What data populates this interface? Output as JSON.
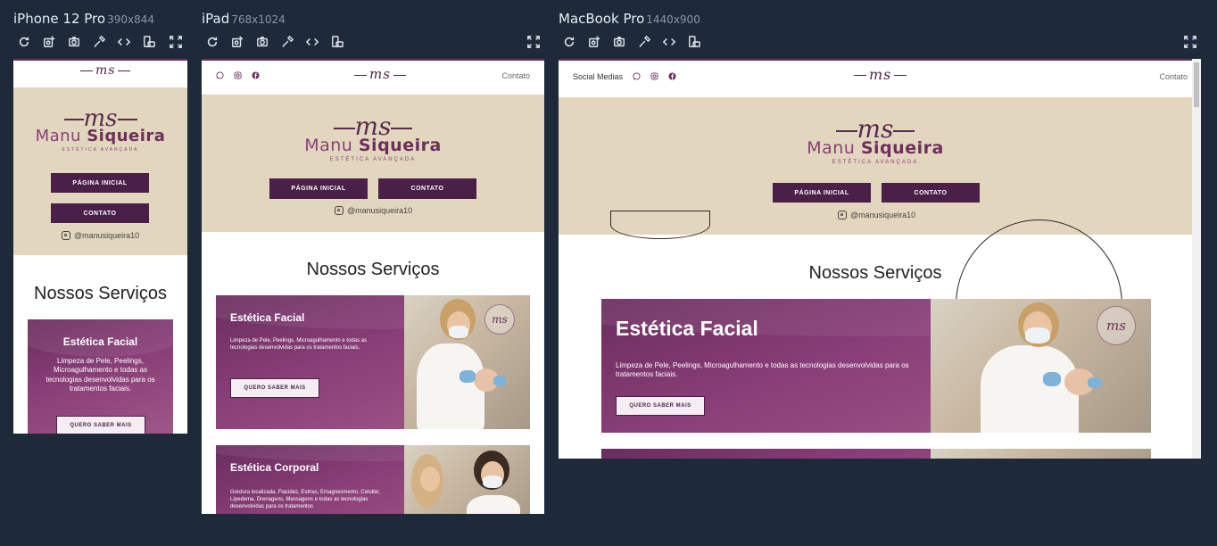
{
  "devices": [
    {
      "name": "iPhone 12 Pro",
      "dims": "390x844"
    },
    {
      "name": "iPad",
      "dims": "768x1024"
    },
    {
      "name": "MacBook Pro",
      "dims": "1440x900"
    }
  ],
  "site": {
    "logo_mark": "ms",
    "brand_name_light": "Manu",
    "brand_name_bold": "Siqueira",
    "brand_tagline": "ESTÉTICA AVANÇADA",
    "nav_contact": "Contato",
    "social_medias_label": "Social Medias",
    "btn_home": "PÁGINA INICIAL",
    "btn_contact": "CONTATO",
    "instagram_handle": "@manusiqueira10",
    "services_title": "Nossos Serviços",
    "card1": {
      "title": "Estética Facial",
      "desc_long": "Limpeza de Pele, Peelings, Microagulhamento e todas as tecnologias desenvolvidas para os tratamentos faciais.",
      "button": "QUERO SABER MAIS"
    },
    "card2": {
      "title": "Estética Corporal",
      "desc": "Gordura localizada, Flacidez, Estrias, Emagrecimento, Celulite, Lipedema, Drenagens, Massagens e todas as tecnologias desenvolvidas para os tratamentos"
    }
  },
  "colors": {
    "background": "#1e2a3a",
    "brand_purple": "#6e2f5a",
    "hero_beige": "#e3d6bf",
    "button_dark": "#4a1f48"
  },
  "icons": [
    "refresh-icon",
    "rotate-icon",
    "camera-icon",
    "eyedropper-icon",
    "code-icon",
    "device-orientation-icon",
    "fullscreen-icon",
    "whatsapp-icon",
    "instagram-icon",
    "facebook-icon"
  ]
}
